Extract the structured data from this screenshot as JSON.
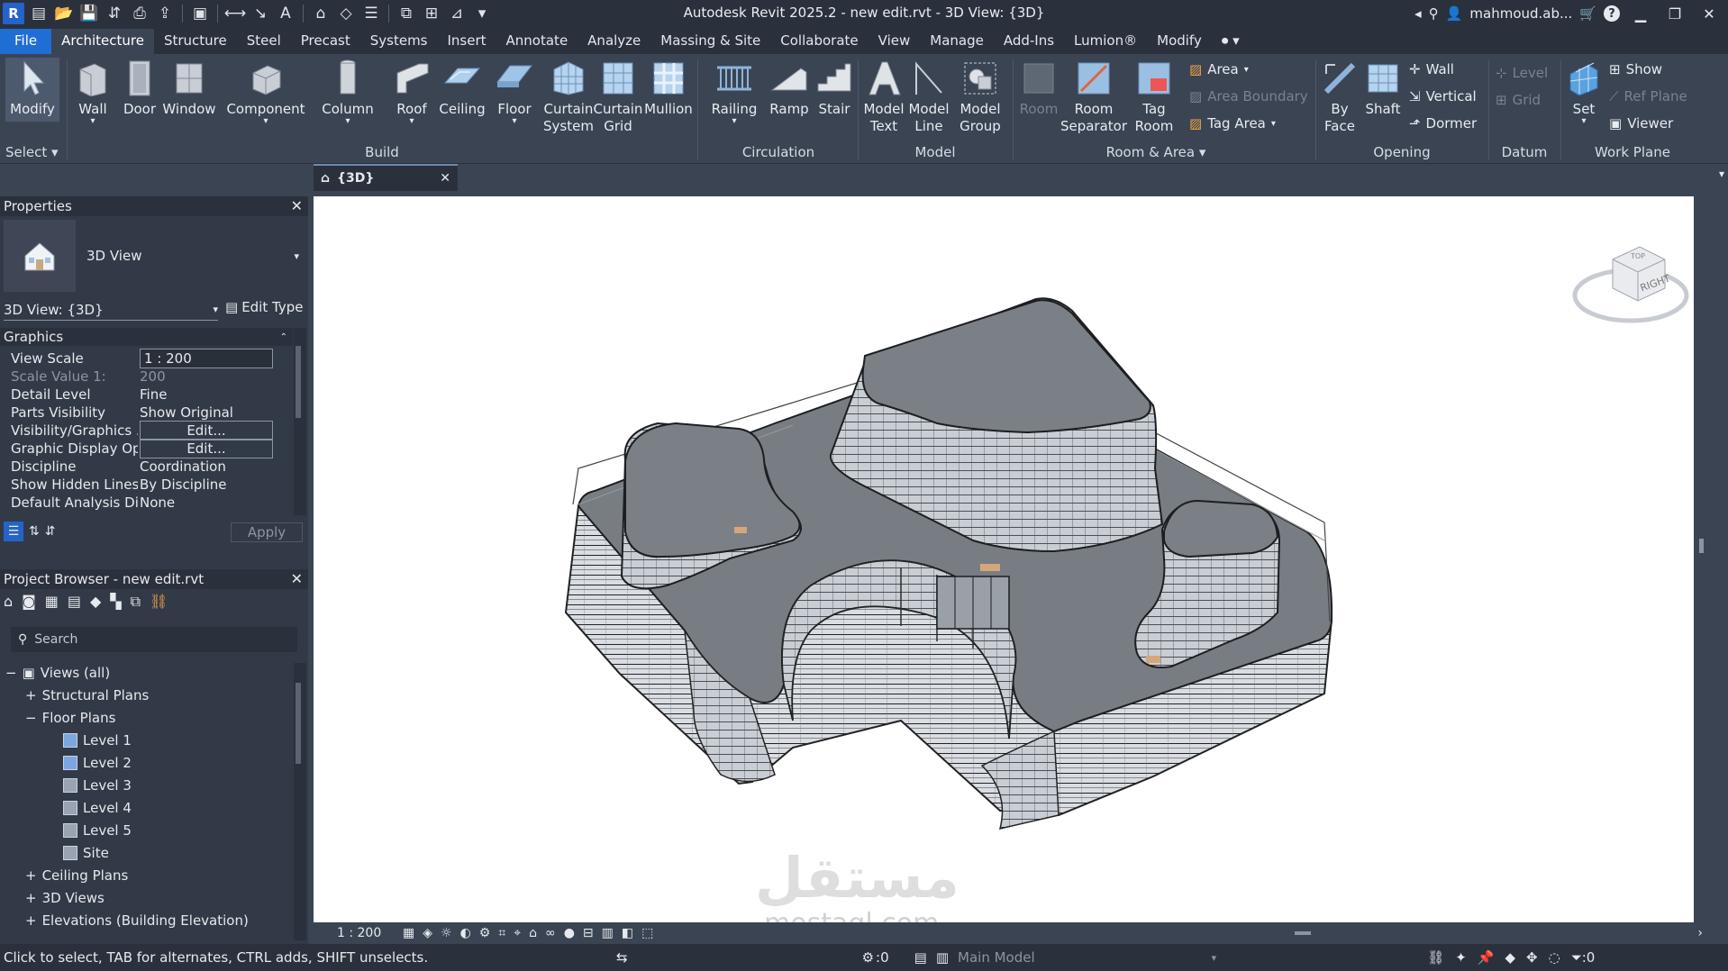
{
  "titlebar": {
    "title": "Autodesk Revit 2025.2 - new edit.rvt - 3D View: {3D}",
    "user": "mahmoud.ab...",
    "help": "?"
  },
  "menu": {
    "tabs": [
      "File",
      "Architecture",
      "Structure",
      "Steel",
      "Precast",
      "Systems",
      "Insert",
      "Annotate",
      "Analyze",
      "Massing & Site",
      "Collaborate",
      "View",
      "Manage",
      "Add-Ins",
      "Lumion®",
      "Modify"
    ]
  },
  "ribbon": {
    "select": {
      "modify": "Modify",
      "panel": "Select"
    },
    "build": {
      "wall": "Wall",
      "door": "Door",
      "window": "Window",
      "component": "Component",
      "column": "Column",
      "roof": "Roof",
      "ceiling": "Ceiling",
      "floor": "Floor",
      "curtain_system_1": "Curtain",
      "curtain_system_2": "System",
      "curtain_grid_1": "Curtain",
      "curtain_grid_2": "Grid",
      "mullion": "Mullion",
      "panel": "Build"
    },
    "circulation": {
      "railing": "Railing",
      "ramp": "Ramp",
      "stair": "Stair",
      "panel": "Circulation"
    },
    "model": {
      "model_text_1": "Model",
      "model_text_2": "Text",
      "model_line_1": "Model",
      "model_line_2": "Line",
      "model_group_1": "Model",
      "model_group_2": "Group",
      "panel": "Model"
    },
    "room": {
      "room": "Room",
      "room_sep_1": "Room",
      "room_sep_2": "Separator",
      "tag_room_1": "Tag",
      "tag_room_2": "Room",
      "area": "Area",
      "area_boundary": "Area  Boundary",
      "tag_area": "Tag  Area",
      "panel": "Room & Area"
    },
    "opening": {
      "by_face_1": "By",
      "by_face_2": "Face",
      "shaft": "Shaft",
      "wall": "Wall",
      "vertical": "Vertical",
      "dormer": "Dormer",
      "panel": "Opening"
    },
    "datum": {
      "level": "Level",
      "grid": "Grid",
      "panel": "Datum"
    },
    "workplane": {
      "set": "Set",
      "show": "Show",
      "ref_plane": "Ref  Plane",
      "viewer": "Viewer",
      "panel": "Work Plane"
    }
  },
  "view_tab": {
    "label": "{3D}"
  },
  "properties": {
    "title": "Properties",
    "type_name": "3D View",
    "instance": "3D View: {3D}",
    "edit_type": "Edit Type",
    "section": "Graphics",
    "rows": [
      {
        "key": "View Scale",
        "value": "1 : 200"
      },
      {
        "key": "Scale Value    1:",
        "value": "200"
      },
      {
        "key": "Detail Level",
        "value": "Fine"
      },
      {
        "key": "Parts Visibility",
        "value": "Show Original"
      },
      {
        "key": "Visibility/Graphics ...",
        "value": "Edit..."
      },
      {
        "key": "Graphic Display Op...",
        "value": "Edit..."
      },
      {
        "key": "Discipline",
        "value": "Coordination"
      },
      {
        "key": "Show Hidden Lines",
        "value": "By Discipline"
      },
      {
        "key": "Default Analysis Dis...",
        "value": "None"
      }
    ],
    "apply": "Apply"
  },
  "browser": {
    "title": "Project Browser - new edit.rvt",
    "search_placeholder": "Search",
    "root": "Views (all)",
    "structural_plans": "Structural Plans",
    "floor_plans": "Floor Plans",
    "levels": [
      "Level 1",
      "Level 2",
      "Level 3",
      "Level 4",
      "Level 5",
      "Site"
    ],
    "ceiling_plans": "Ceiling Plans",
    "views_3d": "3D Views",
    "elevations": "Elevations (Building Elevation)"
  },
  "viewcube": {
    "top": "TOP",
    "right": "RIGHT"
  },
  "view_control": {
    "scale": "1 : 200"
  },
  "statusbar": {
    "hint": "Click to select, TAB for alternates, CTRL adds, SHIFT unselects.",
    "zero1": ":0",
    "model": "Main Model",
    "filter": ":0"
  },
  "watermark": {
    "arabic": "مستقل",
    "latin": "mostaql.com"
  }
}
